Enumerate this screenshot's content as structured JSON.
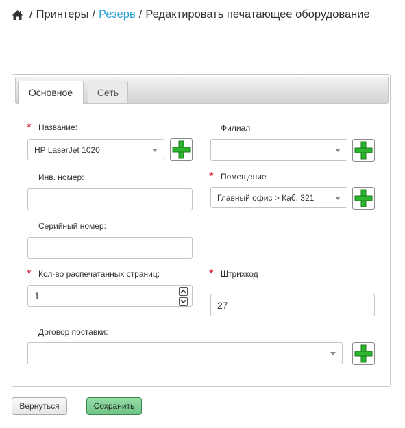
{
  "breadcrumb": {
    "separator": "/",
    "printers": "Принтеры",
    "reserve": "Резерв",
    "current": "Редактировать печатающее оборудование"
  },
  "tabs": [
    {
      "label": "Основное",
      "active": true
    },
    {
      "label": "Сеть",
      "active": false
    }
  ],
  "form": {
    "name": {
      "label": "Название:",
      "required": true,
      "value": "HP LaserJet 1020"
    },
    "branch": {
      "label": "Филиал",
      "required": false,
      "value": ""
    },
    "inv_number": {
      "label": "Инв. номер:",
      "value": ""
    },
    "room": {
      "label": "Помещение",
      "required": true,
      "value": "Главный офис > Каб. 321"
    },
    "serial_number": {
      "label": "Серийный номер:",
      "value": ""
    },
    "pages_printed": {
      "label": "Кол-во распечатанных страниц:",
      "required": true,
      "value": "1"
    },
    "barcode": {
      "label": "Штрихкод",
      "required": true,
      "value": "27"
    },
    "contract": {
      "label": "Договор поставки:",
      "value": ""
    }
  },
  "required_marker": "*",
  "buttons": {
    "back": "Вернуться",
    "save": "Сохранить"
  },
  "colors": {
    "link": "#2a9fd6",
    "required": "#d0021b",
    "add_icon": "#2db52d",
    "save_button": "#7dcb92"
  },
  "icons": {
    "home": "home-icon",
    "add": "plus-icon",
    "dropdown": "chevron-down-icon"
  }
}
